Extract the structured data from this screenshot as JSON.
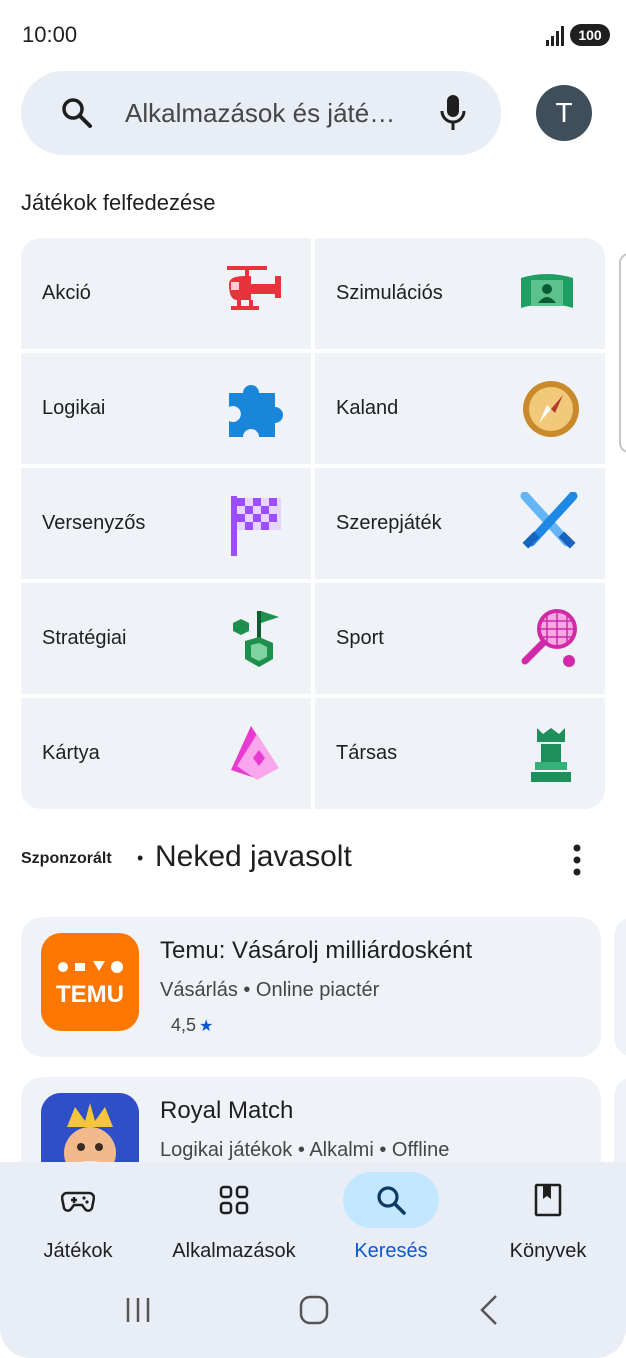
{
  "status_bar": {
    "time": "10:00",
    "battery": "100"
  },
  "search": {
    "placeholder": "Alkalmazások és játé…",
    "avatar_letter": "T"
  },
  "games_section": {
    "title": "Játékok felfedezése",
    "categories": [
      {
        "label": "Akció",
        "icon": "helicopter-icon"
      },
      {
        "label": "Szimulációs",
        "icon": "simulation-icon"
      },
      {
        "label": "Logikai",
        "icon": "puzzle-icon"
      },
      {
        "label": "Kaland",
        "icon": "compass-icon"
      },
      {
        "label": "Versenyzős",
        "icon": "checkered-flag-icon"
      },
      {
        "label": "Szerepjáték",
        "icon": "crossed-swords-icon"
      },
      {
        "label": "Stratégiai",
        "icon": "strategy-icon"
      },
      {
        "label": "Sport",
        "icon": "tennis-racket-icon"
      },
      {
        "label": "Kártya",
        "icon": "cards-icon"
      },
      {
        "label": "Társas",
        "icon": "chess-piece-icon"
      }
    ]
  },
  "sponsored": {
    "label": "Szponzorált",
    "dot": "•",
    "title": "Neked javasolt"
  },
  "apps": [
    {
      "name": "Temu: Vásárolj milliárdosként",
      "meta": "Vásárlás • Online piactér",
      "rating": "4,5",
      "icon_text": "TEMU",
      "icon_color": "#fb7701"
    },
    {
      "name": "Royal Match",
      "meta": "Logikai játékok • Alkalmi • Offline",
      "icon_color": "#3a5bd9"
    }
  ],
  "bottom_nav": {
    "items": [
      {
        "label": "Játékok",
        "icon": "gamepad-icon",
        "active": false
      },
      {
        "label": "Alkalmazások",
        "icon": "apps-grid-icon",
        "active": false
      },
      {
        "label": "Keresés",
        "icon": "search-icon",
        "active": true
      },
      {
        "label": "Könyvek",
        "icon": "book-icon",
        "active": false
      }
    ]
  },
  "colors": {
    "accent": "#0b57d0",
    "active_pill": "#c2e7ff",
    "surface": "#e9eef6",
    "tile_bg": "#eff2f7"
  }
}
